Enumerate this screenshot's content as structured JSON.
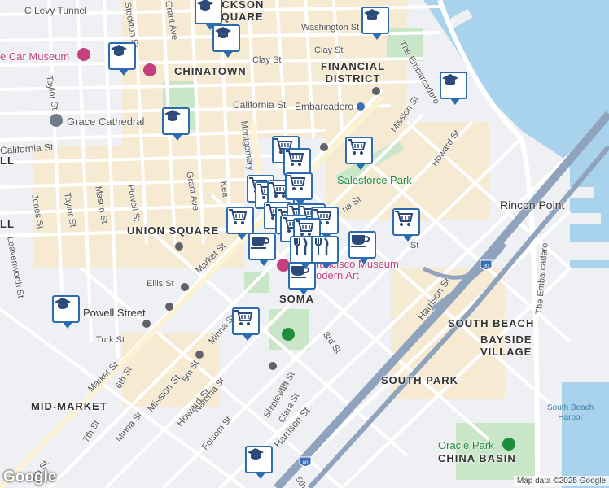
{
  "districts": {
    "jackson_square": "ACKSON\nSQUARE",
    "chinatown": "CHINATOWN",
    "financial_district": "FINANCIAL\nDISTRICT",
    "union_square": "UNION SQUARE",
    "soma": "SOMA",
    "south_beach": "SOUTH BEACH",
    "bayside_village": "BAYSIDE\nVILLAGE",
    "south_park": "SOUTH PARK",
    "mid_market": "MID-MARKET",
    "china_basin": "CHINA BASIN"
  },
  "streets": {
    "broadway_tunnel": "C Levy Tunnel",
    "stockton": "Stockton St",
    "grant_top": "Grant Ave",
    "washington": "Washington St",
    "clay": "Clay St",
    "clay_east": "Clay St",
    "california": "California St",
    "embarcadero": "Embarcadero",
    "california_west": "California St",
    "taylor_top": "Taylor St",
    "mission_ne": "Mission St",
    "howard_ne": "Howard St",
    "the_embarcadero_n": "The Embarcadero",
    "the_embarcadero_s": "The Embarcadero",
    "montgomery": "Montgomery",
    "kearny": "Kea",
    "jones": "Jones St",
    "taylor": "Taylor St",
    "mason": "Mason St",
    "powell": "Powell St",
    "grant": "Grant Ave",
    "leavenworth": "Leavenworth St",
    "market": "Market St",
    "ellis": "Ellis St",
    "powell_street": "Powell Street",
    "turk": "Turk St",
    "minna": "Minna St",
    "fifth": "5th St",
    "natoma": "Natoma St",
    "howard": "Howard St",
    "mission": "Mission St",
    "market_6th": "Market St",
    "sixth": "6th St",
    "seventh": "7th St",
    "minna_2": "Minna St",
    "folsom": "Folsom St",
    "shipley": "Shipley St",
    "clara": "Clara St",
    "fourth": "4th St",
    "harrison": "Harrison St",
    "harrison_2": "Harrison St",
    "third": "3rd St",
    "fifth_s": "5th",
    "eighth": "8th St",
    "rincon_point": "Rincon Point",
    "na_st": "na St",
    "st_near": "St",
    "ll": "LL"
  },
  "pois": {
    "car_museum": "e Car Museum",
    "grace_cathedral": "Grace Cathedral",
    "salesforce_park": "Salesforce Park",
    "sfmoma": "rancisco Museum\nodern Art",
    "oracle_park": "Oracle Park"
  },
  "highway": "80",
  "water": "South Beach\nHarbor",
  "pins": [
    {
      "type": "school",
      "name": "school-pin"
    },
    {
      "type": "shop",
      "name": "shopping-pin"
    },
    {
      "type": "cafe",
      "name": "cafe-pin"
    },
    {
      "type": "restaurant",
      "name": "restaurant-pin"
    }
  ],
  "colors": {
    "water": "#a9d3ec",
    "pin_border": "#2b6cb0",
    "park": "#c9e7c8",
    "highway": "#8fa3bd"
  },
  "attribution": "Map data ©2025 Google",
  "logo": "Google"
}
